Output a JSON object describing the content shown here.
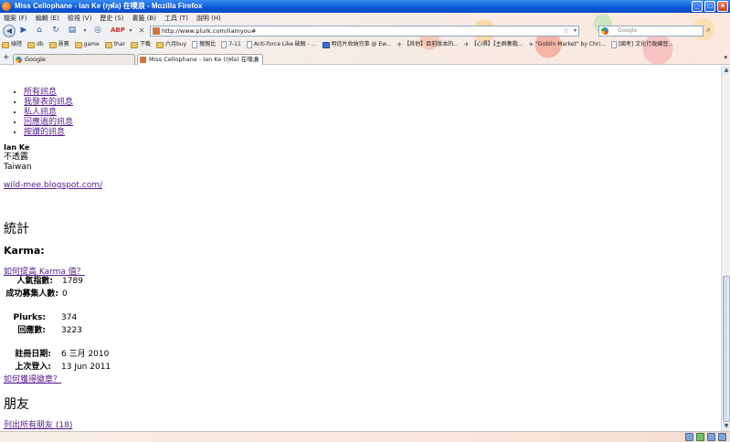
{
  "window": {
    "title": "Miss Cellophane - Ian Ke (กุฬa) 在噗浪 - Mozilla Firefox"
  },
  "menubar": {
    "items": [
      "檔案 (F)",
      "編輯 (E)",
      "檢視 (V)",
      "歷史 (S)",
      "書籤 (B)",
      "工具 (T)",
      "說明 (H)"
    ]
  },
  "navbar": {
    "url": "http://www.plurk.com/iiamyou#",
    "search_placeholder": "Google"
  },
  "bookmarks": {
    "items": [
      "綠隱",
      "db",
      "慧寶",
      "game",
      "thar",
      "下載",
      "六月buy",
      "親親比",
      "7-11",
      "Anti-force Like 破解 - ...",
      "明信片收納完事 @ Ew...",
      "【其他】目前版本的...",
      "【心得】【主群集戰...",
      "\"Goblin Market\" by Chri...",
      "[國考] 文化行政練習..."
    ]
  },
  "tabs": [
    {
      "label": "Google"
    },
    {
      "label": "Miss Cellophane - Ian Ke (กุฬa) 在噗浪"
    }
  ],
  "page": {
    "menu_links": [
      "所有訊息",
      "我發表的訊息",
      "私人訊息",
      "回應過的訊息",
      "按讚的訊息"
    ],
    "profile": {
      "name": "Ian Ke",
      "gender": "不透露",
      "location": "Taiwan"
    },
    "blog_url": "wild-mee.blogspot.com/",
    "stats_title": "統計",
    "karma_title": "Karma:",
    "karma_link": "如何提高 Karma 值？",
    "stats": [
      {
        "label": "人氣指數:",
        "value": "1789"
      },
      {
        "label": "成功募集人數:",
        "value": "0"
      },
      {
        "label": "Plurks:",
        "value": "374"
      },
      {
        "label": "回應數:",
        "value": "3223"
      },
      {
        "label": "註冊日期:",
        "value": "6 三月 2010"
      },
      {
        "label": "上次登入:",
        "value": "13 Jun 2011"
      }
    ],
    "badge_link": "如何獲得徽章？",
    "friends_title": "朋友",
    "friends_link": "列出所有朋友 (18)"
  }
}
